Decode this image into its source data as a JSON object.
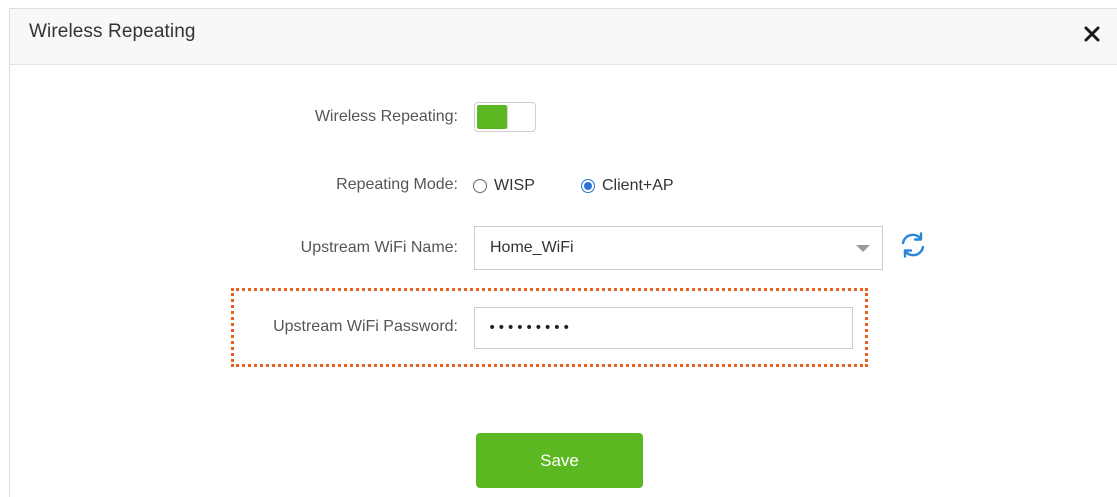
{
  "dialog": {
    "title": "Wireless Repeating",
    "close_icon": "close-icon"
  },
  "form": {
    "wireless_repeating": {
      "label": "Wireless Repeating:",
      "enabled": true
    },
    "repeating_mode": {
      "label": "Repeating Mode:",
      "options": [
        "WISP",
        "Client+AP"
      ],
      "selected": "Client+AP"
    },
    "upstream_wifi_name": {
      "label": "Upstream WiFi Name:",
      "value": "Home_WiFi",
      "refresh_icon": "refresh-icon"
    },
    "upstream_wifi_password": {
      "label": "Upstream WiFi Password:",
      "value": "•••••••••"
    }
  },
  "actions": {
    "save_label": "Save"
  },
  "colors": {
    "accent_green": "#5bb820",
    "radio_blue": "#2a73d9",
    "highlight_orange": "#e8611e",
    "refresh_blue": "#2a86d8"
  }
}
